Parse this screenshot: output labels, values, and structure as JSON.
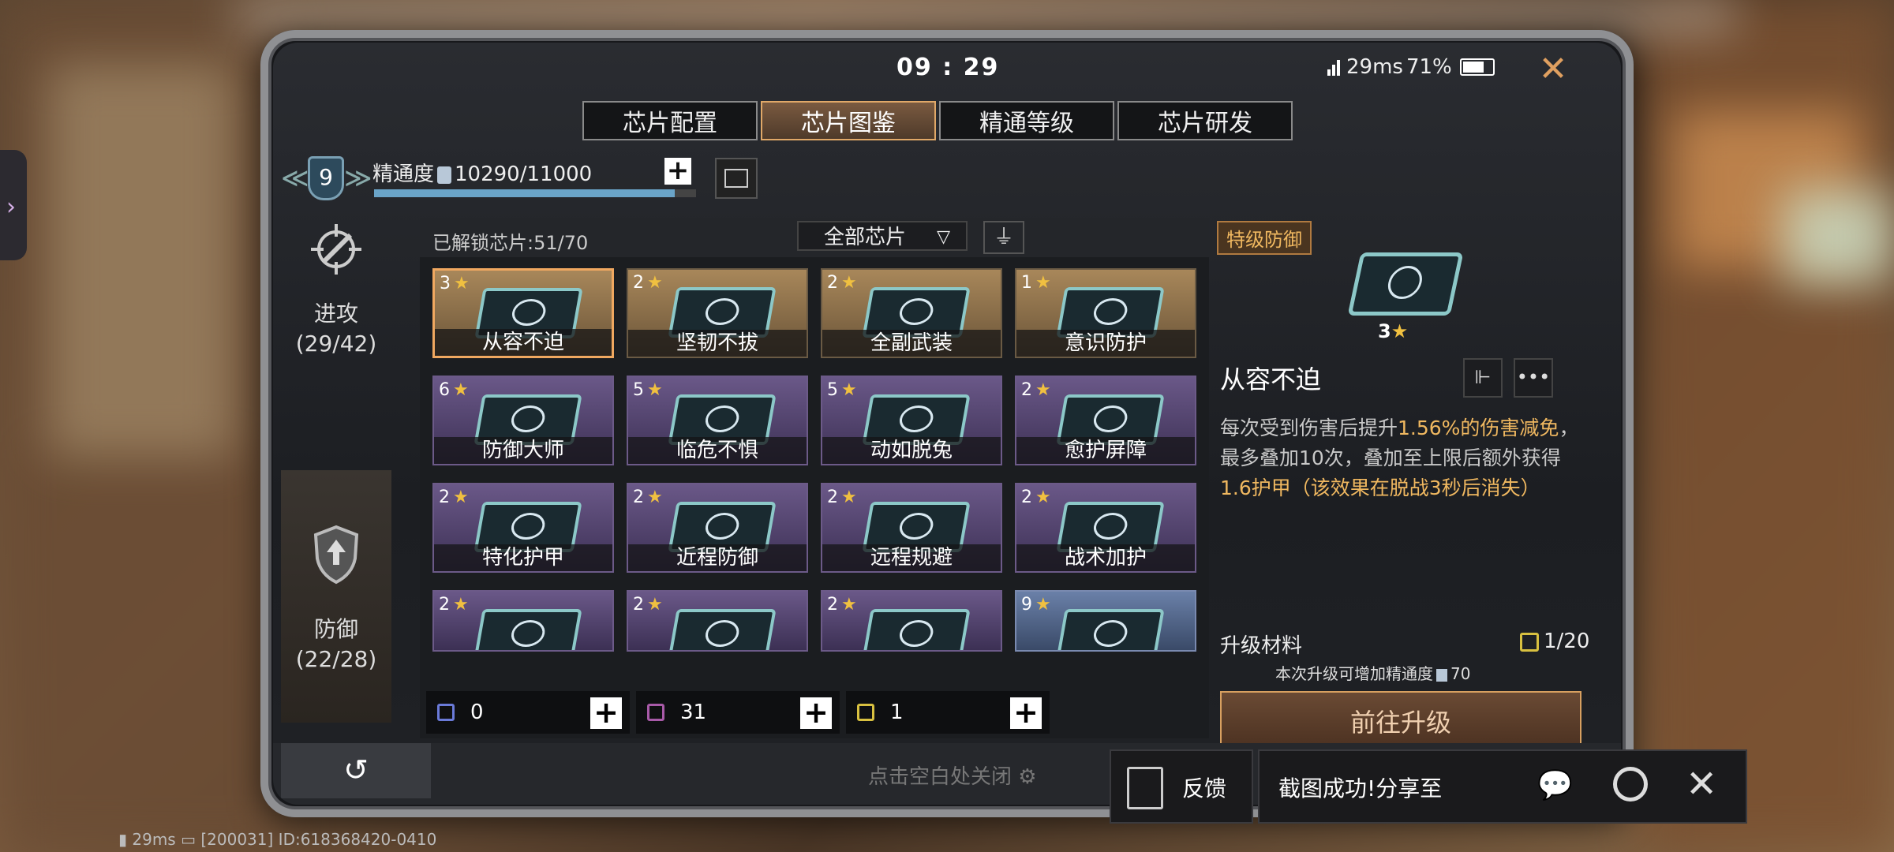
{
  "status": {
    "time": "09 : 29",
    "ping": "29ms",
    "battery": "71%"
  },
  "tabs": [
    {
      "label": "芯片配置",
      "active": false
    },
    {
      "label": "芯片图鉴",
      "active": true
    },
    {
      "label": "精通等级",
      "active": false
    },
    {
      "label": "芯片研发",
      "active": false
    }
  ],
  "rank": {
    "level": "9",
    "mastery_label": "精通度",
    "mastery_value": "10290/11000",
    "mastery_fraction": 0.935
  },
  "sidebar": [
    {
      "label": "进攻",
      "count": "(29/42)",
      "icon": "attack-crosshair-icon",
      "active": false
    },
    {
      "label": "防御",
      "count": "(22/28)",
      "icon": "defense-shield-icon",
      "active": true
    }
  ],
  "grid": {
    "unlocked": "已解锁芯片:51/70",
    "filter": "全部芯片",
    "chips": [
      {
        "stars": "3",
        "name": "从容不迫",
        "rarity": "gold",
        "selected": true
      },
      {
        "stars": "2",
        "name": "坚韧不拔",
        "rarity": "gold"
      },
      {
        "stars": "2",
        "name": "全副武装",
        "rarity": "gold"
      },
      {
        "stars": "1",
        "name": "意识防护",
        "rarity": "gold"
      },
      {
        "stars": "6",
        "name": "防御大师",
        "rarity": "purple"
      },
      {
        "stars": "5",
        "name": "临危不惧",
        "rarity": "purple"
      },
      {
        "stars": "5",
        "name": "动如脱兔",
        "rarity": "purple"
      },
      {
        "stars": "2",
        "name": "愈护屏障",
        "rarity": "purple"
      },
      {
        "stars": "2",
        "name": "特化护甲",
        "rarity": "purple"
      },
      {
        "stars": "2",
        "name": "近程防御",
        "rarity": "purple"
      },
      {
        "stars": "2",
        "name": "远程规避",
        "rarity": "purple"
      },
      {
        "stars": "2",
        "name": "战术加护",
        "rarity": "purple"
      },
      {
        "stars": "2",
        "name": "",
        "rarity": "purple"
      },
      {
        "stars": "2",
        "name": "",
        "rarity": "purple"
      },
      {
        "stars": "2",
        "name": "",
        "rarity": "purple"
      },
      {
        "stars": "9",
        "name": "",
        "rarity": "blue"
      }
    ]
  },
  "materials": [
    {
      "value": "0",
      "color": "#6a7ad8"
    },
    {
      "value": "31",
      "color": "#a85aa8"
    },
    {
      "value": "1",
      "color": "#d8c040"
    }
  ],
  "detail": {
    "badge": "特级防御",
    "stars": "3",
    "name": "从容不迫",
    "desc_1": "每次受到伤害后提升",
    "desc_hl_1": "1.56%的伤害减免",
    "desc_2": "，最多叠加10次，叠加至上限后额外获得",
    "desc_hl_2": "1.6护甲（该效果在脱战3秒后消失）",
    "upgrade_label": "升级材料",
    "upgrade_count": "1/20",
    "upgrade_sub_1": "本次升级可增加精通度",
    "upgrade_sub_2": "70",
    "upgrade_button": "前往升级"
  },
  "bottom": {
    "tap_close": "点击空白处关闭"
  },
  "feedback": {
    "label": "反馈"
  },
  "share": {
    "label": "截图成功!分享至"
  },
  "footer": {
    "ping": "29ms",
    "id": "[200031] ID:618368420-0410"
  }
}
